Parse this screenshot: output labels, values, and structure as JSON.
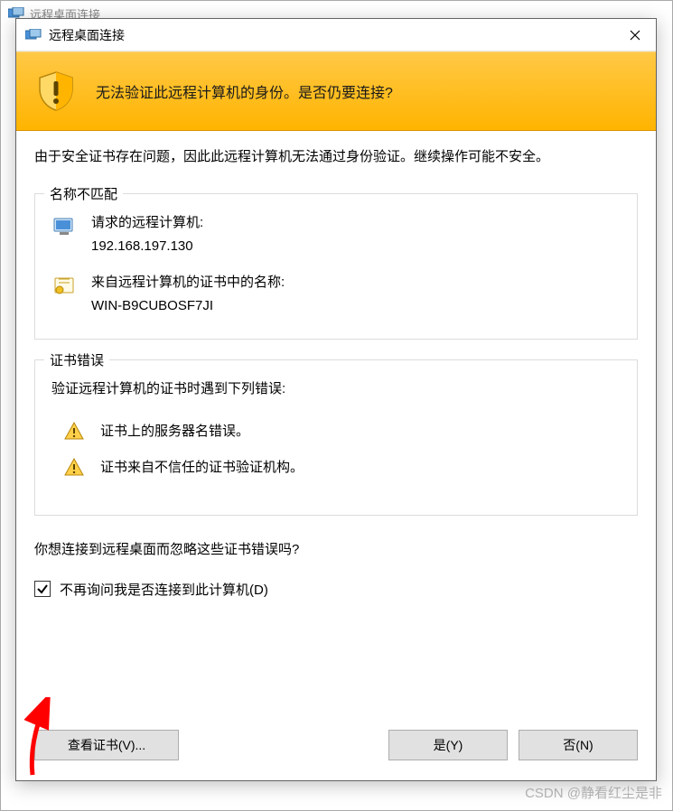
{
  "parent": {
    "title": "远程桌面连接"
  },
  "dialog": {
    "title": "远程桌面连接"
  },
  "banner": {
    "message": "无法验证此远程计算机的身份。是否仍要连接?"
  },
  "intro": "由于安全证书存在问题，因此此远程计算机无法通过身份验证。继续操作可能不安全。",
  "mismatch": {
    "title": "名称不匹配",
    "requested_label": "请求的远程计算机:",
    "requested_value": "192.168.197.130",
    "cert_label": "来自远程计算机的证书中的名称:",
    "cert_value": "WIN-B9CUBOSF7JI"
  },
  "cert_errors": {
    "title": "证书错误",
    "intro": "验证远程计算机的证书时遇到下列错误:",
    "items": [
      "证书上的服务器名错误。",
      "证书来自不信任的证书验证机构。"
    ]
  },
  "question": "你想连接到远程桌面而忽略这些证书错误吗?",
  "checkbox_label": "不再询问我是否连接到此计算机(D)",
  "buttons": {
    "view_cert": "查看证书(V)...",
    "yes": "是(Y)",
    "no": "否(N)"
  },
  "watermark": "CSDN @静看红尘是非"
}
